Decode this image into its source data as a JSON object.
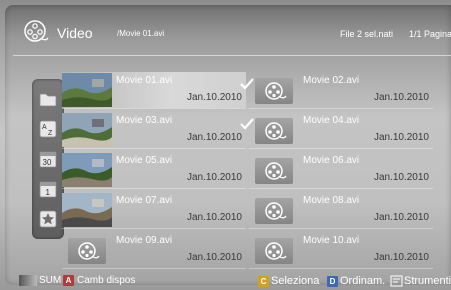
{
  "header": {
    "title": "Video",
    "current_file": "/Movie 01.avi",
    "selected_files": "File 2 sel.nati",
    "page_indicator": "1/1 Pagina"
  },
  "sidebar": {
    "items": [
      {
        "icon": "folder-icon"
      },
      {
        "icon": "sort-az-icon"
      },
      {
        "icon": "calendar-30-icon"
      },
      {
        "icon": "calendar-1-icon"
      },
      {
        "icon": "star-icon"
      }
    ]
  },
  "files": [
    {
      "name": "Movie 01.avi",
      "date": "Jan.10.2010",
      "thumb": "photo",
      "focused": true,
      "checked": false
    },
    {
      "name": "Movie 02.avi",
      "date": "Jan.10.2010",
      "thumb": "film",
      "focused": false,
      "checked": true
    },
    {
      "name": "Movie 03.avi",
      "date": "Jan.10.2010",
      "thumb": "photo",
      "focused": false,
      "checked": false
    },
    {
      "name": "Movie 04.avi",
      "date": "Jan.10.2010",
      "thumb": "film",
      "focused": false,
      "checked": true
    },
    {
      "name": "Movie 05.avi",
      "date": "Jan.10.2010",
      "thumb": "photo",
      "focused": false,
      "checked": false
    },
    {
      "name": "Movie 06.avi",
      "date": "Jan.10.2010",
      "thumb": "film",
      "focused": false,
      "checked": false
    },
    {
      "name": "Movie 07.avi",
      "date": "Jan.10.2010",
      "thumb": "photo",
      "focused": false,
      "checked": false
    },
    {
      "name": "Movie 08.avi",
      "date": "Jan.10.2010",
      "thumb": "film",
      "focused": false,
      "checked": false
    },
    {
      "name": "Movie 09.avi",
      "date": "Jan.10.2010",
      "thumb": "film",
      "focused": false,
      "checked": false
    },
    {
      "name": "Movie 10.avi",
      "date": "Jan.10.2010",
      "thumb": "film",
      "focused": false,
      "checked": false
    }
  ],
  "footer": {
    "sum_label": "SUM",
    "a_key": "A",
    "a_label": "Camb dispos",
    "c_key": "C",
    "c_label": "Seleziona",
    "d_key": "D",
    "d_label": "Ordinam.",
    "tools_label": "Strumenti"
  },
  "colors": {
    "key_a": "#b33a3a",
    "key_c": "#d0a21c",
    "key_d": "#3c68b5"
  }
}
